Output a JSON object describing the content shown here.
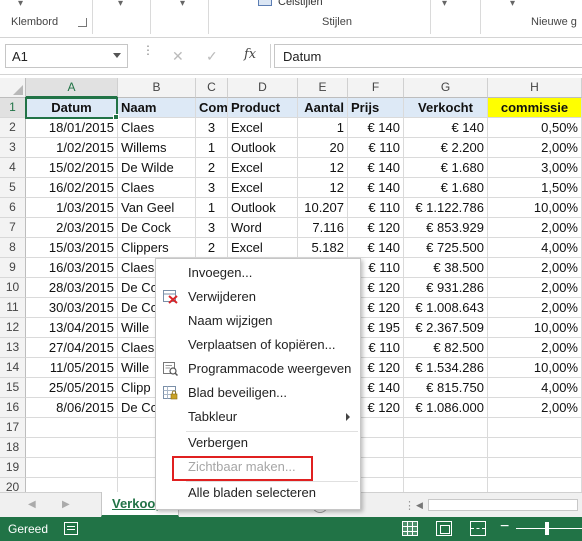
{
  "ribbon": {
    "clipboard_label": "Klembord",
    "styles_label": "Stijlen",
    "cell_styles_btn": "Celstijlen",
    "new_group_label": "Nieuwe g"
  },
  "formula_bar": {
    "namebox": "A1",
    "fx": "fx",
    "formula": "Datum"
  },
  "columns": [
    "A",
    "B",
    "C",
    "D",
    "E",
    "F",
    "G",
    "H"
  ],
  "rows": [
    "1",
    "2",
    "3",
    "4",
    "5",
    "6",
    "7",
    "8",
    "9",
    "10",
    "11",
    "12",
    "13",
    "14",
    "15",
    "16",
    "17",
    "18",
    "19",
    "20"
  ],
  "headers": [
    "Datum",
    "Naam",
    "Com",
    "Product",
    "Aantal",
    "Prijs",
    "Verkocht",
    "commissie"
  ],
  "data": [
    [
      "18/01/2015",
      "Claes",
      "3",
      "Excel",
      "1",
      "€ 140",
      "€ 140",
      "0,50%"
    ],
    [
      "1/02/2015",
      "Willems",
      "1",
      "Outlook",
      "20",
      "€ 110",
      "€ 2.200",
      "2,00%"
    ],
    [
      "15/02/2015",
      "De Wilde",
      "2",
      "Excel",
      "12",
      "€ 140",
      "€ 1.680",
      "3,00%"
    ],
    [
      "16/02/2015",
      "Claes",
      "3",
      "Excel",
      "12",
      "€ 140",
      "€ 1.680",
      "1,50%"
    ],
    [
      "1/03/2015",
      "Van Geel",
      "1",
      "Outlook",
      "10.207",
      "€ 110",
      "€ 1.122.786",
      "10,00%"
    ],
    [
      "2/03/2015",
      "De Cock",
      "3",
      "Word",
      "7.116",
      "€ 120",
      "€ 853.929",
      "2,00%"
    ],
    [
      "15/03/2015",
      "Clippers",
      "2",
      "Excel",
      "5.182",
      "€ 140",
      "€ 725.500",
      "4,00%"
    ],
    [
      "16/03/2015",
      "Claes",
      "",
      "",
      "",
      "€ 110",
      "€ 38.500",
      "2,00%"
    ],
    [
      "28/03/2015",
      "De Co",
      "",
      "",
      "",
      "€ 120",
      "€ 931.286",
      "2,00%"
    ],
    [
      "30/03/2015",
      "De Co",
      "",
      "",
      "",
      "€ 120",
      "€ 1.008.643",
      "2,00%"
    ],
    [
      "13/04/2015",
      "Wille",
      "",
      "",
      "",
      "€ 195",
      "€ 2.367.509",
      "10,00%"
    ],
    [
      "27/04/2015",
      "Claes",
      "",
      "",
      "",
      "€ 110",
      "€ 82.500",
      "2,00%"
    ],
    [
      "11/05/2015",
      "Wille",
      "",
      "",
      "",
      "€ 120",
      "€ 1.534.286",
      "10,00%"
    ],
    [
      "25/05/2015",
      "Clipp",
      "",
      "",
      "",
      "€ 140",
      "€ 815.750",
      "4,00%"
    ],
    [
      "8/06/2015",
      "De Co",
      "",
      "",
      "",
      "€ 120",
      "€ 1.086.000",
      "2,00%"
    ]
  ],
  "context_menu": {
    "insert": "Invoegen...",
    "delete": "Verwijderen",
    "rename": "Naam wijzigen",
    "move_copy": "Verplaatsen of kopiëren...",
    "view_code": "Programmacode weergeven",
    "protect": "Blad beveiligen...",
    "tab_color": "Tabkleur",
    "hide": "Verbergen",
    "unhide": "Zichtbaar maken...",
    "select_all": "Alle bladen selecteren"
  },
  "sheet_tabs": {
    "active": "Verkoop",
    "add": "+"
  },
  "status": {
    "ready": "Gereed"
  },
  "colors": {
    "excel_green": "#217346",
    "header_fill": "#dde9f6",
    "highlight_yellow": "#ffff00",
    "outline_red": "#e02020"
  }
}
